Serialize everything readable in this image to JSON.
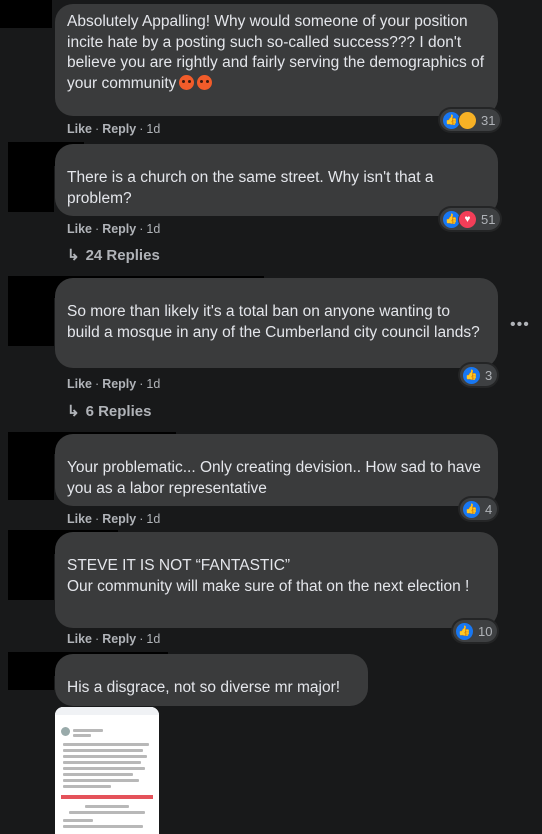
{
  "comments": [
    {
      "text": "Absolutely Appalling! Why would someone of your position incite hate by a posting such so-called success??? I don't believe you are rightly and fairly serving the demographics of your community",
      "like": "Like",
      "reply": "Reply",
      "time": "1d",
      "reactions": "31"
    },
    {
      "text": "There is a church on the same street. Why isn't that a problem?",
      "like": "Like",
      "reply": "Reply",
      "time": "1d",
      "reactions": "51",
      "replies": "24 Replies"
    },
    {
      "text": "So more than likely it's a total ban on anyone wanting to build a mosque in any of the Cumberland city council lands?",
      "like": "Like",
      "reply": "Reply",
      "time": "1d",
      "reactions": "3",
      "replies": "6 Replies"
    },
    {
      "text": "Your problematic... Only creating devision.. How sad to have you as a labor representative",
      "like": "Like",
      "reply": "Reply",
      "time": "1d",
      "reactions": "4"
    },
    {
      "text_line1": "STEVE IT IS NOT “FANTASTIC”",
      "text_line2": "Our community will make sure of that on the next election !",
      "like": "Like",
      "reply": "Reply",
      "time": "1d",
      "reactions": "10"
    },
    {
      "text": "His a disgrace, not so diverse mr major!"
    }
  ],
  "icons": {
    "like": "thumbs-up-icon",
    "love": "heart-icon",
    "angry": "angry-face-icon",
    "care": "care-face-icon",
    "reply_arrow": "reply-arrow-icon",
    "more": "more-options-icon"
  },
  "colors": {
    "background": "#18191a",
    "bubble": "#3a3b3c",
    "like_blue": "#1877f2",
    "love_red": "#f33e58"
  }
}
